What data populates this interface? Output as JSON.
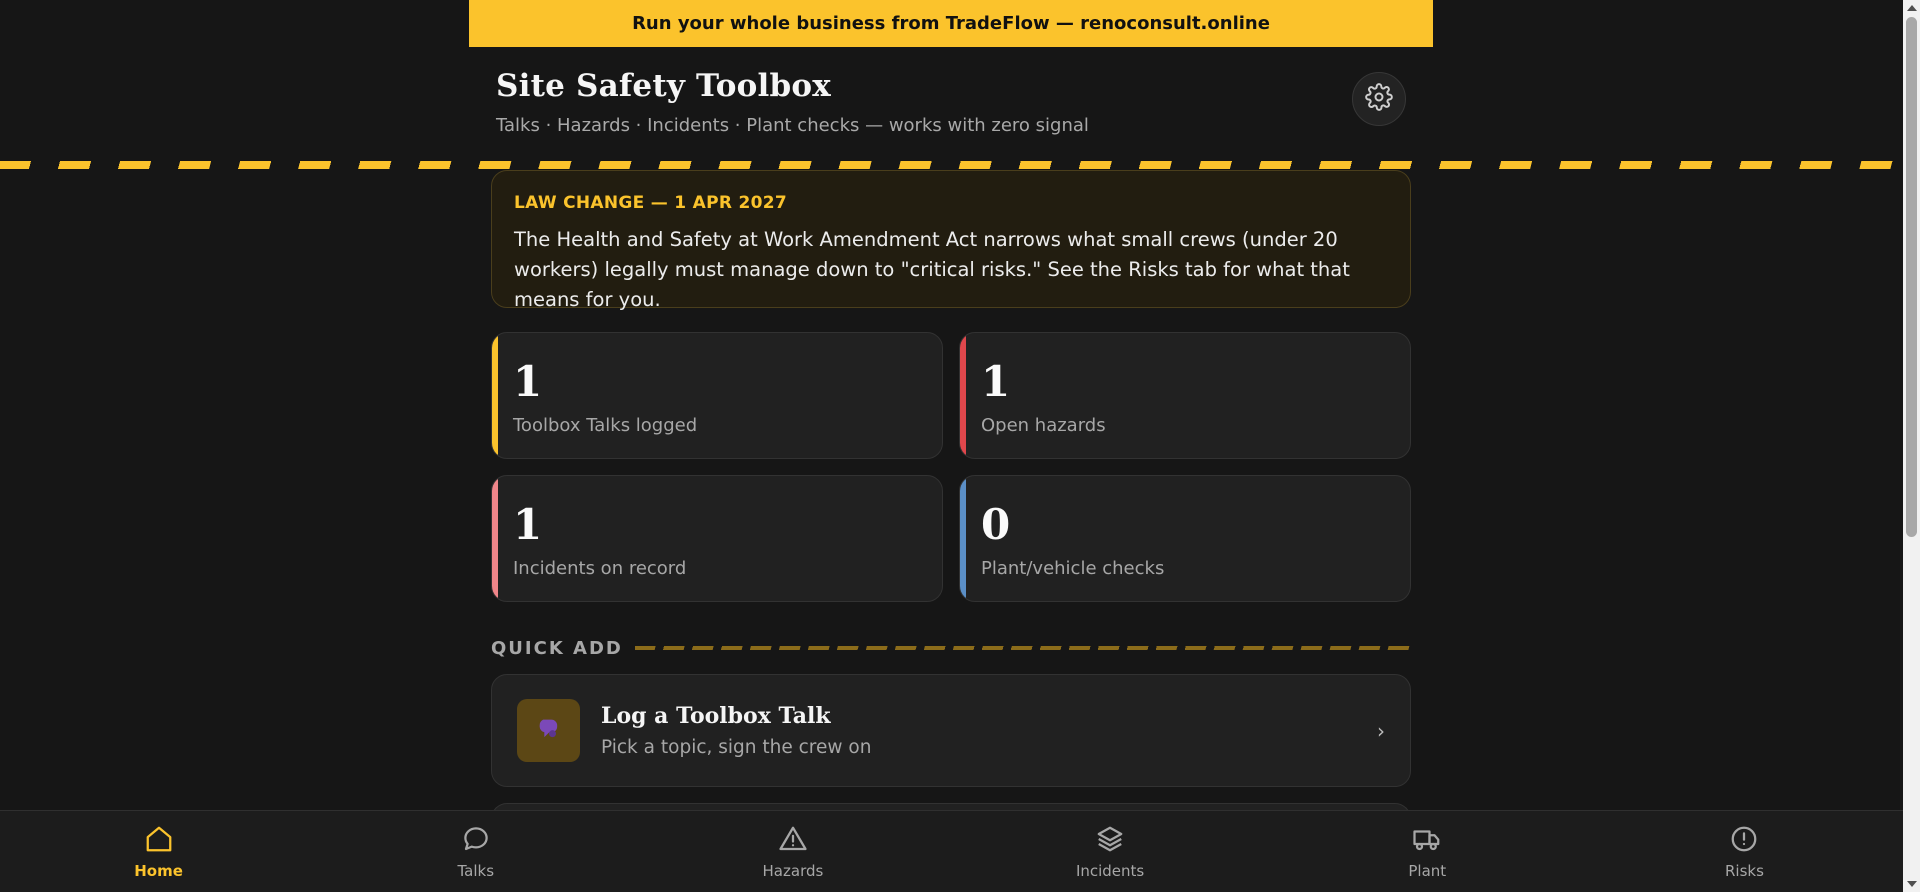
{
  "promo": {
    "text": "Run your whole business from TradeFlow — renoconsult.online"
  },
  "header": {
    "title": "Site Safety Toolbox",
    "subtitle": "Talks · Hazards · Incidents · Plant checks — works with zero signal",
    "settings_icon": "gear-icon"
  },
  "law_notice": {
    "heading": "LAW CHANGE — 1 APR 2027",
    "body": "The Health and Safety at Work Amendment Act narrows what small crews (under 20 workers) legally must manage down to \"critical risks.\" See the Risks tab for what that means for you."
  },
  "stats": [
    {
      "value": "1",
      "label": "Toolbox Talks logged",
      "accent": "#fbc32c"
    },
    {
      "value": "1",
      "label": "Open hazards",
      "accent": "#e0474c"
    },
    {
      "value": "1",
      "label": "Incidents on record",
      "accent": "#f0868a"
    },
    {
      "value": "0",
      "label": "Plant/vehicle checks",
      "accent": "#5b8fc7"
    }
  ],
  "quick_add": {
    "title": "QUICK ADD",
    "items": [
      {
        "title": "Log a Toolbox Talk",
        "subtitle": "Pick a topic, sign the crew on",
        "icon": "speech-bubble-icon"
      }
    ]
  },
  "nav": {
    "items": [
      {
        "label": "Home",
        "icon": "home-icon",
        "active": true
      },
      {
        "label": "Talks",
        "icon": "chat-icon",
        "active": false
      },
      {
        "label": "Hazards",
        "icon": "warning-icon",
        "active": false
      },
      {
        "label": "Incidents",
        "icon": "layers-icon",
        "active": false
      },
      {
        "label": "Plant",
        "icon": "truck-icon",
        "active": false
      },
      {
        "label": "Risks",
        "icon": "alert-circle-icon",
        "active": false
      }
    ]
  },
  "colors": {
    "accent": "#fbc32c",
    "background": "#161616",
    "card": "#212121"
  }
}
